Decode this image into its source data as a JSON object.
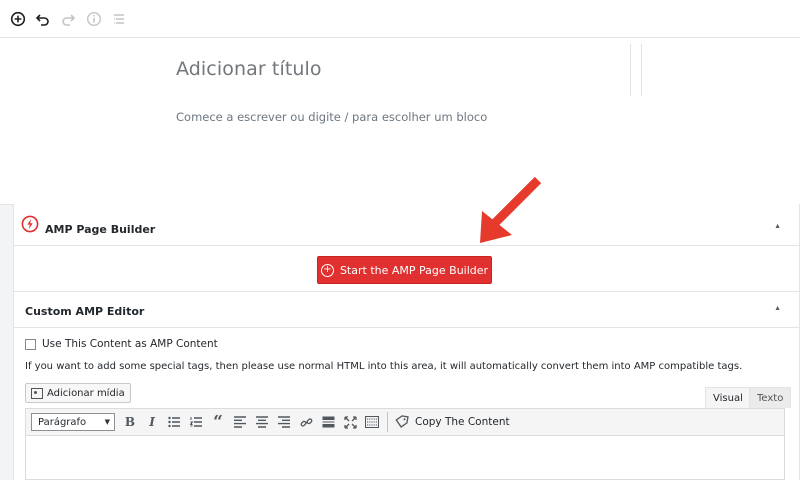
{
  "toolbar_top": {
    "icons": [
      "add-block-icon",
      "undo-icon",
      "redo-icon",
      "info-icon",
      "outline-icon"
    ]
  },
  "editor": {
    "title_placeholder": "Adicionar título",
    "body_placeholder": "Comece a escrever ou digite / para escolher um bloco"
  },
  "amp_panel": {
    "title": "AMP Page Builder",
    "button_label": "Start the AMP Page Builder",
    "accent": "#e03030"
  },
  "custom_panel": {
    "title": "Custom AMP Editor",
    "checkbox_label": "Use This Content as AMP Content",
    "help_text": "If you want to add some special tags, then please use normal HTML into this area, it will automatically convert them into AMP compatible tags.",
    "media_button": "Adicionar mídia",
    "tabs": [
      "Visual",
      "Texto"
    ],
    "format_select": "Parágrafo",
    "copy_button": "Copy The Content"
  }
}
